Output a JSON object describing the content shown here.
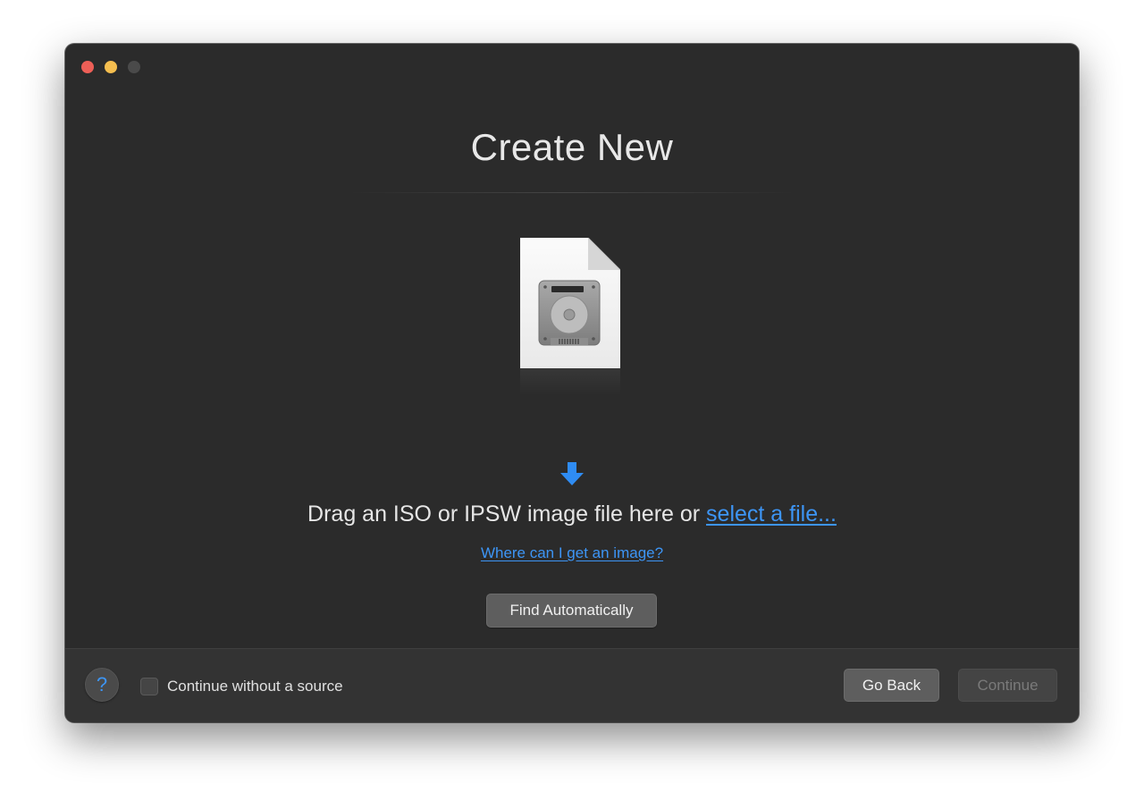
{
  "window": {
    "title": "Create New",
    "traffic_lights": [
      "close",
      "minimize",
      "zoom-disabled"
    ]
  },
  "main": {
    "drop_icon": "disk-image-document-icon",
    "arrow_icon": "arrow-down-icon",
    "drag_text": "Drag an ISO or IPSW image file here or",
    "select_link": "select a file...",
    "where_link": "Where can I get an image?",
    "find_button": "Find Automatically"
  },
  "footer": {
    "help_label": "?",
    "checkbox_label": "Continue without a source",
    "checkbox_checked": false,
    "go_back_label": "Go Back",
    "continue_label": "Continue",
    "continue_enabled": false
  },
  "colors": {
    "window_bg": "#2b2b2b",
    "footer_bg": "#333333",
    "accent_blue": "#3d95f5",
    "close_red": "#ed5f57",
    "minimize_yellow": "#f5be4f"
  }
}
